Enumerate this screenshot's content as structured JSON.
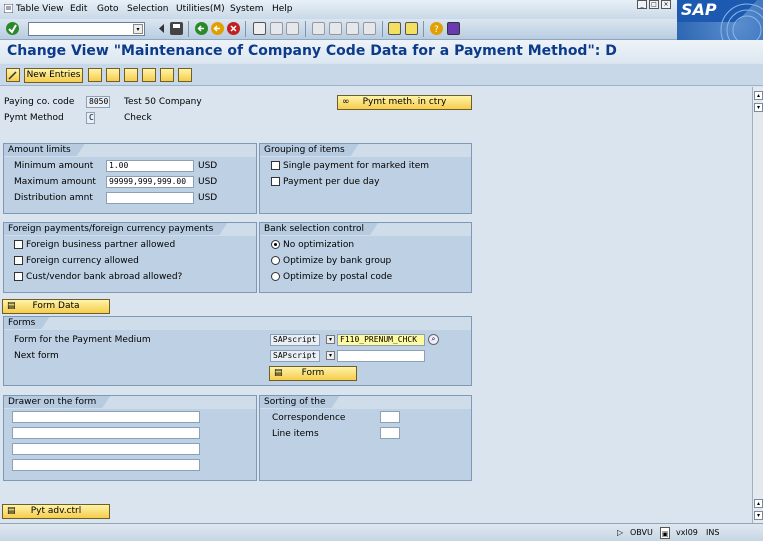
{
  "menu": {
    "items": [
      "Table View",
      "Edit",
      "Goto",
      "Selection",
      "Utilities(M)",
      "System",
      "Help"
    ]
  },
  "toolbar": {
    "command_field_value": "",
    "icons": [
      "check-icon",
      "save-icon",
      "back-icon",
      "exit-icon",
      "cancel-icon",
      "print-icon",
      "find-icon",
      "find-next-icon",
      "first-page-icon",
      "prev-page-icon",
      "next-page-icon",
      "last-page-icon",
      "new-session-icon",
      "shortcut-icon",
      "help-icon",
      "layout-icon"
    ]
  },
  "title": "Change View \"Maintenance of Company Code Data for a Payment Method\": D",
  "app_toolbar": {
    "new_entries_label": "New Entries"
  },
  "header": {
    "paying_cc_label": "Paying co. code",
    "paying_cc_value": "8050",
    "paying_cc_text": "Test 50 Company",
    "pymt_method_label": "Pymt Method",
    "pymt_method_value": "C",
    "pymt_method_text": "Check",
    "pymt_meth_ctry_button": "Pymt meth. in ctry"
  },
  "amount_limits": {
    "title": "Amount limits",
    "min_label": "Minimum amount",
    "min_value": "1.00",
    "min_currency": "USD",
    "max_label": "Maximum amount",
    "max_value": "99999,999,999.00",
    "max_currency": "USD",
    "dist_label": "Distribution amnt",
    "dist_value": "",
    "dist_currency": "USD"
  },
  "grouping": {
    "title": "Grouping of items",
    "single_payment": "Single payment for marked item",
    "per_due_day": "Payment per due day"
  },
  "foreign": {
    "title": "Foreign payments/foreign currency payments",
    "bp_allowed": "Foreign business partner allowed",
    "currency_allowed": "Foreign currency allowed",
    "bank_abroad": "Cust/vendor bank abroad allowed?"
  },
  "bank_selection": {
    "title": "Bank selection control",
    "no_opt": "No optimization",
    "by_bank_group": "Optimize by bank group",
    "by_postal": "Optimize by postal code",
    "selected": "no_opt"
  },
  "form_data_button": "Form Data",
  "forms": {
    "title": "Forms",
    "pm_label": "Form for the Payment Medium",
    "pm_type": "SAPscript",
    "pm_value": "F110_PRENUM_CHCK",
    "next_label": "Next form",
    "next_type": "SAPscript",
    "next_value": "",
    "form_button": "Form"
  },
  "drawer": {
    "title": "Drawer on the form",
    "lines": [
      "",
      "",
      "",
      ""
    ]
  },
  "sorting": {
    "title": "Sorting of the",
    "correspondence": "Correspondence",
    "correspondence_value": "",
    "line_items": "Line items",
    "line_items_value": ""
  },
  "pyt_adv_button": "Pyt adv.ctrl",
  "status": {
    "system": "OBVU",
    "client": "vxl09",
    "mode": "INS"
  }
}
